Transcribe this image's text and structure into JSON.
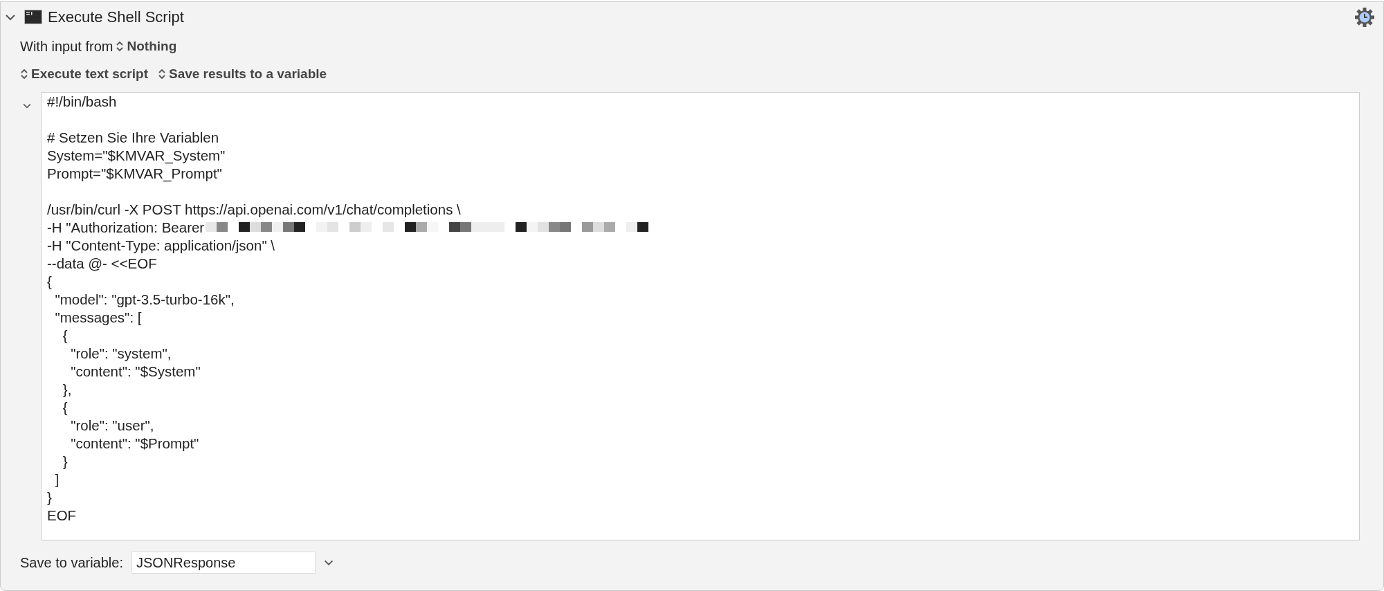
{
  "action": {
    "title": "Execute Shell Script",
    "expanded": true
  },
  "input_row": {
    "label": "With input from",
    "value": "Nothing"
  },
  "options": [
    {
      "value": "Execute text script"
    },
    {
      "value": "Save results to a variable"
    }
  ],
  "script": {
    "expanded": true,
    "blocks": [
      [
        {
          "kind": "text",
          "text": "#!/bin/bash"
        }
      ],
      [
        {
          "kind": "text",
          "text": "# Setzen Sie Ihre Variablen"
        },
        {
          "kind": "text",
          "text": "System=\"$KMVAR_System\""
        },
        {
          "kind": "text",
          "text": "Prompt=\"$KMVAR_Prompt\""
        }
      ],
      [
        {
          "kind": "text",
          "text": "/usr/bin/curl -X POST https://api.openai.com/v1/chat/completions \\"
        },
        {
          "kind": "redacted",
          "text": "-H \"Authorization: Bearer"
        },
        {
          "kind": "text",
          "text": "-H \"Content-Type: application/json\" \\"
        },
        {
          "kind": "text",
          "text": "--data @- <<EOF"
        },
        {
          "kind": "text",
          "text": "{"
        },
        {
          "kind": "text",
          "text": "  \"model\": \"gpt-3.5-turbo-16k\","
        },
        {
          "kind": "text",
          "text": "  \"messages\": ["
        },
        {
          "kind": "text",
          "text": "    {"
        },
        {
          "kind": "text",
          "text": "      \"role\": \"system\","
        },
        {
          "kind": "text",
          "text": "      \"content\": \"$System\""
        },
        {
          "kind": "text",
          "text": "    },"
        },
        {
          "kind": "text",
          "text": "    {"
        },
        {
          "kind": "text",
          "text": "      \"role\": \"user\","
        },
        {
          "kind": "text",
          "text": "      \"content\": \"$Prompt\""
        },
        {
          "kind": "text",
          "text": "    }"
        },
        {
          "kind": "text",
          "text": "  ]"
        },
        {
          "kind": "text",
          "text": "}"
        },
        {
          "kind": "text",
          "text": "EOF"
        }
      ]
    ]
  },
  "save_row": {
    "label": "Save to variable:",
    "value": "JSONResponse"
  }
}
